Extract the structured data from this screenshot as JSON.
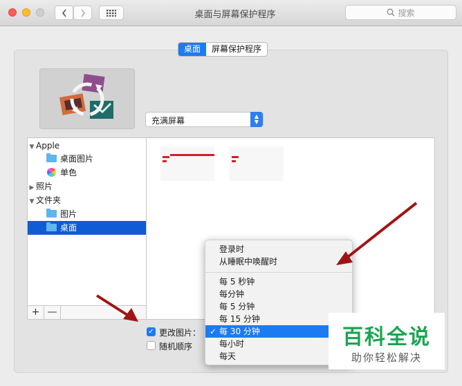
{
  "window": {
    "title": "桌面与屏幕保护程序"
  },
  "toolbar": {
    "search_placeholder": "搜索",
    "grid_icon": "grid-icon",
    "back_icon": "chevron-left-icon",
    "forward_icon": "chevron-right-icon"
  },
  "tabs": [
    {
      "label": "桌面",
      "active": true
    },
    {
      "label": "屏幕保护程序",
      "active": false
    }
  ],
  "fill_mode": {
    "value": "充满屏幕"
  },
  "sidebar": {
    "items": [
      {
        "label": "Apple"
      },
      {
        "label": "桌面图片"
      },
      {
        "label": "单色"
      },
      {
        "label": "照片"
      },
      {
        "label": "文件夹"
      },
      {
        "label": "图片"
      },
      {
        "label": "桌面",
        "selected": true
      }
    ],
    "add_label": "+",
    "remove_label": "—"
  },
  "options": {
    "change_picture": {
      "label": "更改图片：",
      "checked": true
    },
    "random_order": {
      "label": "随机顺序",
      "checked": false
    }
  },
  "interval_menu": {
    "items": [
      {
        "label": "登录时"
      },
      {
        "label": "从睡眠中唤醒时"
      },
      {
        "label": "每 5 秒钟"
      },
      {
        "label": "每分钟"
      },
      {
        "label": "每 5 分钟"
      },
      {
        "label": "每 15 分钟"
      },
      {
        "label": "每 30 分钟",
        "selected": true
      },
      {
        "label": "每小时"
      },
      {
        "label": "每天"
      }
    ],
    "check_mark": "✓"
  },
  "watermark": {
    "title": "百科全说",
    "subtitle": "助你轻松解决"
  },
  "colors": {
    "accent": "#1c7bf1",
    "selection": "#0f5cd4",
    "arrow": "#a01414",
    "watermark_green": "#1aa551"
  }
}
